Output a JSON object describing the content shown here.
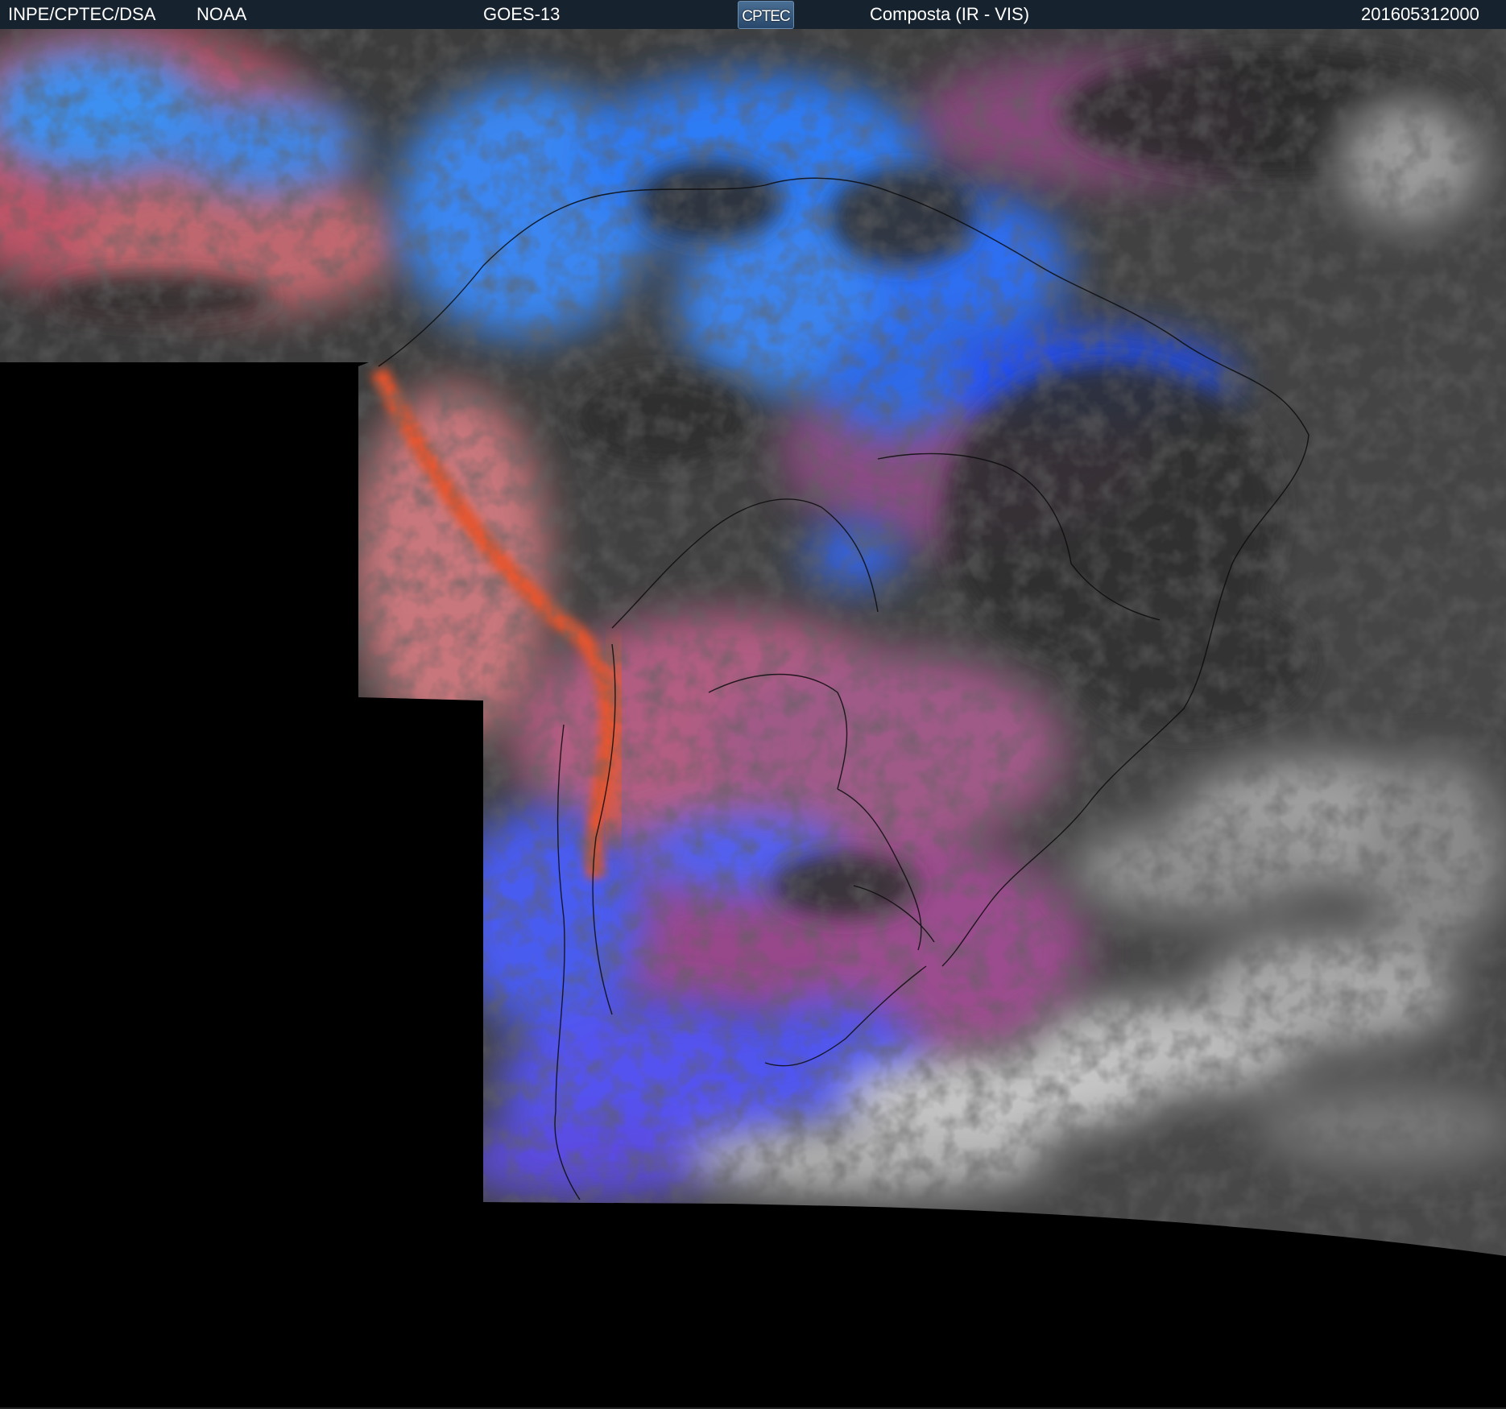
{
  "header": {
    "agency": "INPE/CPTEC/DSA",
    "source": "NOAA",
    "satellite": "GOES-13",
    "logo_text": "CPTEC",
    "product": "Composta (IR - VIS)",
    "timestamp": "201605312000"
  },
  "colors": {
    "header_bg": "#16222e",
    "background": "#000000",
    "cold_cloud_blue": "#2f6cf0",
    "warm_surface_red": "#d6604f",
    "vis_cloud_gray": "#b5b5b5"
  }
}
